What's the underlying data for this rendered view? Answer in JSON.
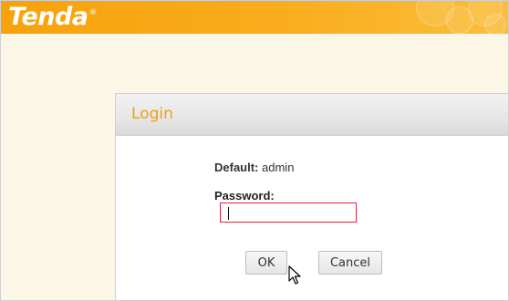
{
  "header": {
    "logo_text": "Tenda",
    "logo_mark": "®",
    "background_color": "#f7a20a"
  },
  "login_dialog": {
    "title": "Login",
    "title_color": "#f39c12",
    "default_label": "Default:",
    "default_value": "admin",
    "password_label": "Password:",
    "password_value": "",
    "password_border_color": "#d9263b",
    "ok_label": "OK",
    "cancel_label": "Cancel"
  },
  "icons": {
    "cursor": "mouse-pointer-icon"
  }
}
